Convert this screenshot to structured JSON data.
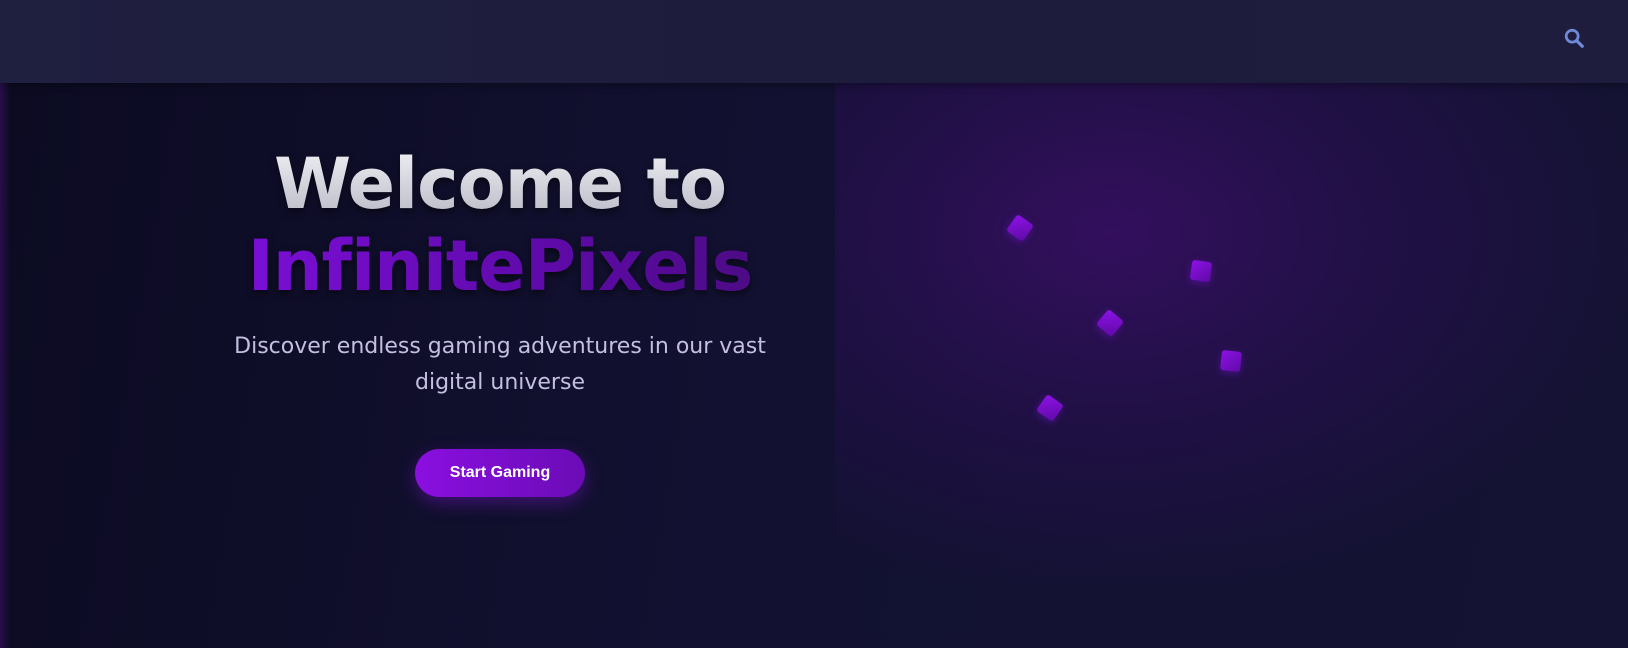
{
  "header": {
    "search_icon": "search-icon"
  },
  "hero": {
    "title_line1": "Welcome to",
    "title_line2": "InfinitePixels",
    "subtitle": "Discover endless gaming adventures in our vast digital universe",
    "cta_label": "Start Gaming"
  },
  "colors": {
    "accent": "#7a0ed6",
    "header_bg": "#1f1f40",
    "hero_bg": "#121131",
    "search_icon": "#6f8ad8"
  }
}
